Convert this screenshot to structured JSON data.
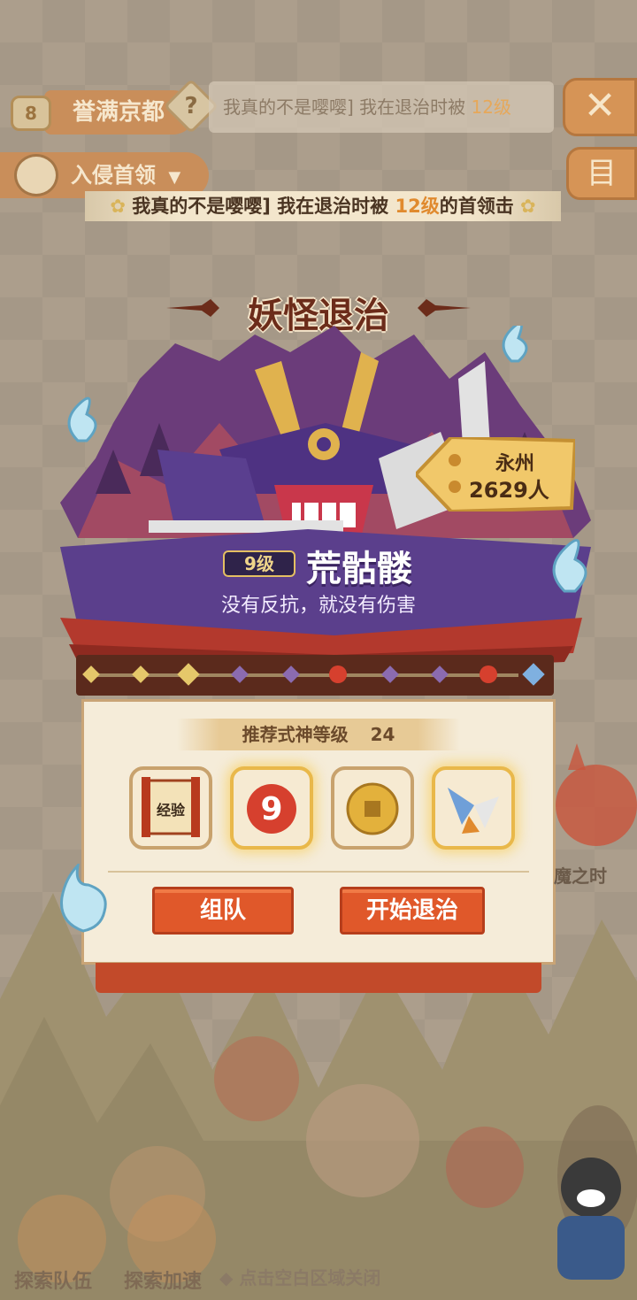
{
  "hud": {
    "level": "8",
    "area_title": "誉满京都",
    "help_glyph": "?",
    "ticker_text": "我真的不是嘤嘤] 我在退治时被",
    "ticker_level": "12级",
    "close_glyph": "✕",
    "invade_label": "入侵首领",
    "invade_caret": "▼",
    "menu_glyph": "目"
  },
  "notice": {
    "text_before": "我真的不是嘤嘤] 我在退治时被",
    "level": "12级",
    "text_after": "的首领击",
    "deco": "✿"
  },
  "card": {
    "title": "妖怪退治",
    "boss_level": "9级",
    "boss_name": "荒骷髅",
    "boss_quote": "没有反抗，就没有伤害",
    "location": {
      "city": "永州",
      "count": "2629人"
    }
  },
  "panel": {
    "recommend_label": "推荐式神等级",
    "recommend_level": "24",
    "rewards": [
      {
        "name": "exp-scroll",
        "label": "经验"
      },
      {
        "name": "red-daruma-9",
        "label": ""
      },
      {
        "name": "gold-coin",
        "label": ""
      },
      {
        "name": "paper-bird",
        "label": ""
      }
    ],
    "team_button": "组队",
    "start_button": "开始退治"
  },
  "side": {
    "event_text": "魔之时"
  },
  "bottom": {
    "explore_team": "探索队伍",
    "explore_speed": "探索加速",
    "hint": "◆ 点击空白区域关闭"
  },
  "colors": {
    "accent": "#e0582a",
    "title_brown": "#6c2c1a",
    "purple": "#5a3f8f",
    "gold": "#e4bf62"
  }
}
